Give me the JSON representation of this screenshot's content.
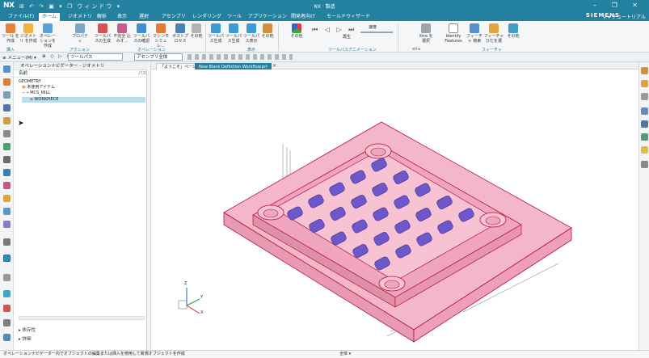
{
  "titlebar": {
    "app_logo": "NX",
    "quick_access": "⊞ ↶ ↷ ▣ ▾ ❐ ウィンドウ ▾",
    "title": "NX · 製造",
    "win_controls": "– ❐ ✕"
  },
  "menu": {
    "tabs": [
      "ファイル(F)",
      "ホーム",
      "ジオメトリ",
      "解析",
      "表示",
      "選択",
      "アセンブリ",
      "レンダリング",
      "ツール",
      "アプリケーション",
      "開発者向け",
      "モールドウィザード"
    ],
    "active_tab": "ホーム",
    "brand": "SIEMENS",
    "search": "⚲ ▾ チュートリアル"
  },
  "ribbon": {
    "buttons": [
      "ツール を作成",
      "ジオメトリ を作成",
      "オペレー ションを作成",
      "プロパティ",
      "ツールパ スの生成",
      "不完全 込みオ...",
      "ツールパ スの確認",
      "マシンモ シミュレ...",
      "ポストプ ロセス",
      "その他",
      "ツールパ ス生成",
      "ツールパ ス生成",
      "ツールパ ス表示",
      "その他",
      "その他",
      "Xtra を選択",
      "Identify Features",
      "フィーチャ 検索",
      "フィーチャ ひだを選",
      "その他"
    ],
    "group_labels": [
      "挿入",
      "アクション",
      "オペレーション",
      "表示",
      "ツールパスアニメーション",
      "xtra",
      "フィーチャ"
    ],
    "playback_label": "再生",
    "speed_label": "速度"
  },
  "commandbar": {
    "menu": "≡ メニュー(M) ▾",
    "filter_combo": "ツールパス",
    "assembly_combo": "アセンブリ全体",
    "tools": "⊕ ◇ ▷ ⊙"
  },
  "nav": {
    "header": "オペレーションナビゲーター - ジオメトリ",
    "column_name": "名前",
    "column_path": "パス",
    "tree": {
      "root": "GEOMETRY",
      "unused": "未使用アイテム",
      "mcs": "MCS_MILL",
      "workpiece": "WORKPIECE"
    },
    "sections": [
      "依存性",
      "詳細"
    ]
  },
  "doc_tabs": [
    "「ようこそ」ページ",
    "New Blank Definition Workflow.prt"
  ],
  "triad": {
    "x": "X",
    "y": "Y",
    "z": "Z"
  },
  "status": {
    "message": "オペレーションナビゲーター内でオブジェクトの編集または挿入を使用して新規オブジェクトを作成",
    "selection": "全体 ▾"
  },
  "colors": {
    "accent": "#23809e",
    "workpiece_fill": "#f0a5be",
    "workpiece_edge": "#b5123f",
    "pocket_fill": "#6d57c9"
  },
  "icons": {
    "cursor": "arrow-cursor",
    "tabs_close": "close-icon"
  }
}
